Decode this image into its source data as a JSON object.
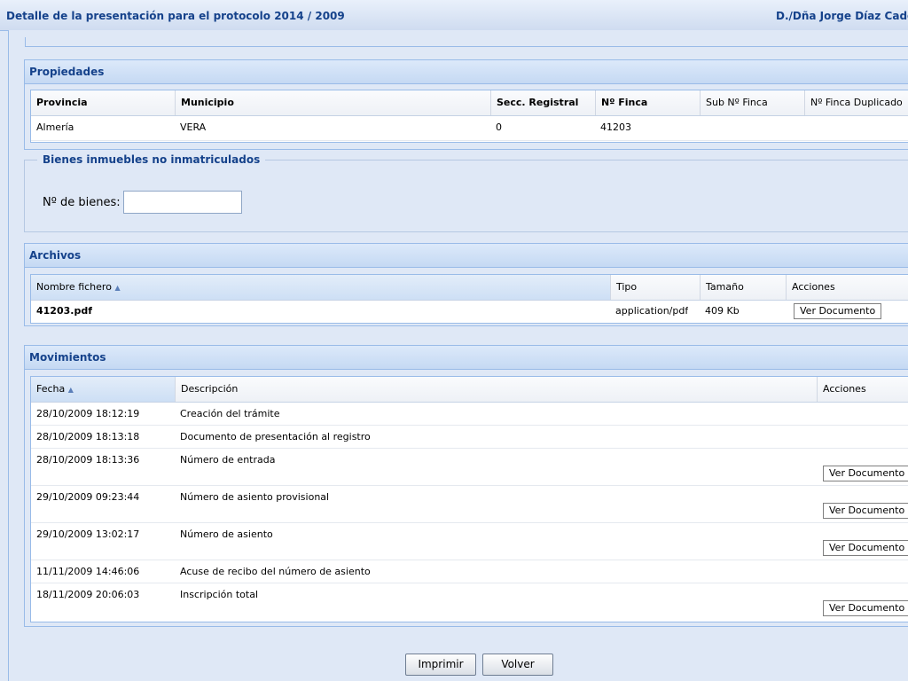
{
  "window": {
    "title": "Detalle de la presentación para el protocolo 2014 / 2009",
    "user": "D./Dña Jorge Díaz Cadó"
  },
  "propiedades": {
    "header": "Propiedades",
    "columns": [
      "Provincia",
      "Municipio",
      "Secc. Registral",
      "Nº Finca",
      "Sub Nº Finca",
      "Nº Finca Duplicado"
    ],
    "rows": [
      [
        "Almería",
        "VERA",
        "0",
        "41203",
        "",
        ""
      ]
    ]
  },
  "bienes": {
    "legend": "Bienes inmuebles no inmatriculados",
    "label": "Nº de bienes:",
    "value": ""
  },
  "archivos": {
    "header": "Archivos",
    "columns": [
      "Nombre fichero",
      "Tipo",
      "Tamaño",
      "Acciones"
    ],
    "sort_icon": "sort-asc-icon",
    "rows": [
      {
        "nombre": "41203.pdf",
        "tipo": "application/pdf",
        "tamano": "409 Kb",
        "accion": "Ver Documento"
      }
    ]
  },
  "movimientos": {
    "header": "Movimientos",
    "columns": [
      "Fecha",
      "Descripción",
      "Acciones"
    ],
    "sort_icon": "sort-asc-icon",
    "rows": [
      {
        "fecha": "28/10/2009 18:12:19",
        "descripcion": "Creación del trámite",
        "accion": ""
      },
      {
        "fecha": "28/10/2009 18:13:18",
        "descripcion": "Documento de presentación al registro",
        "accion": ""
      },
      {
        "fecha": "28/10/2009 18:13:36",
        "descripcion": "Número de entrada",
        "accion": "Ver Documento"
      },
      {
        "fecha": "29/10/2009 09:23:44",
        "descripcion": "Número de asiento provisional",
        "accion": "Ver Documento"
      },
      {
        "fecha": "29/10/2009 13:02:17",
        "descripcion": "Número de asiento",
        "accion": "Ver Documento"
      },
      {
        "fecha": "11/11/2009 14:46:06",
        "descripcion": "Acuse de recibo del número de asiento",
        "accion": ""
      },
      {
        "fecha": "18/11/2009 20:06:03",
        "descripcion": "Inscripción total",
        "accion": "Ver Documento"
      }
    ]
  },
  "footer": {
    "print_label": "Imprimir",
    "back_label": "Volver"
  },
  "colors": {
    "accent": "#15428b",
    "panel_bg": "#dfe8f6",
    "border": "#99bbe8"
  }
}
